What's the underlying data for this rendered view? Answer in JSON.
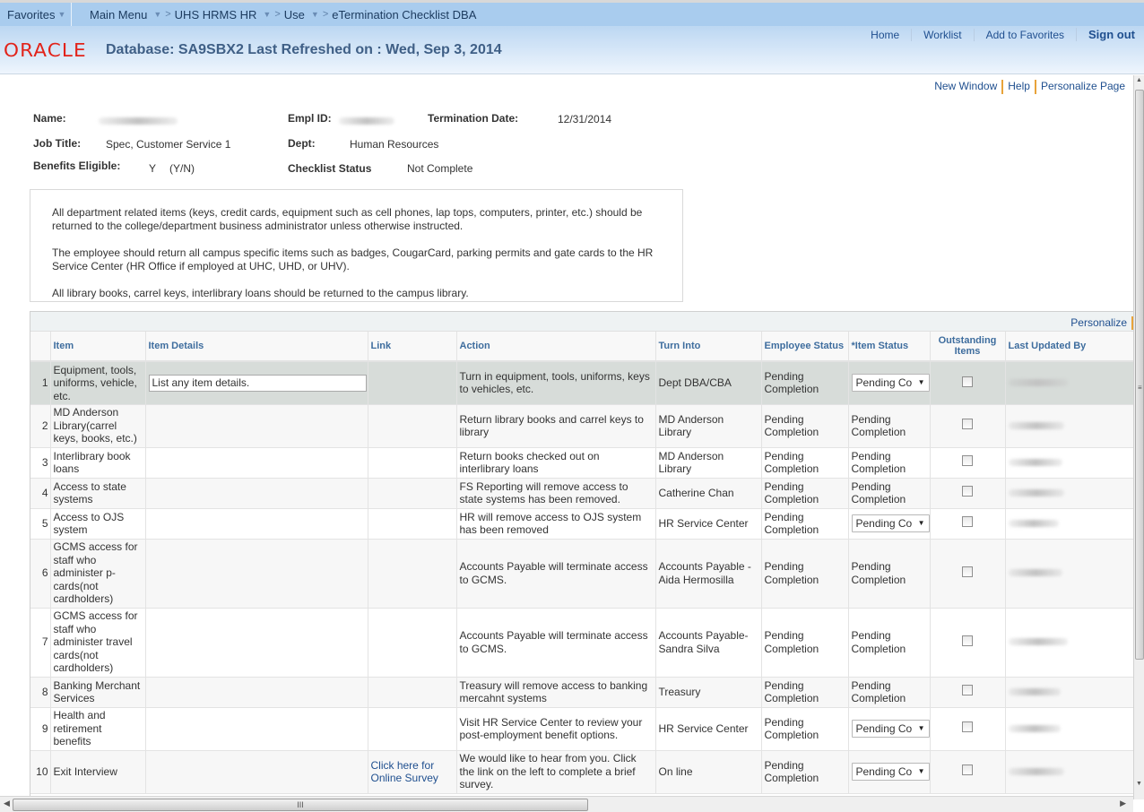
{
  "nav": {
    "favorites": "Favorites",
    "breadcrumb": [
      {
        "label": "Main Menu",
        "dropdown": true
      },
      {
        "label": "UHS HRMS HR",
        "dropdown": true
      },
      {
        "label": "Use",
        "dropdown": true
      },
      {
        "label": "eTermination Checklist DBA",
        "dropdown": false
      }
    ],
    "separator": ">"
  },
  "header": {
    "logo": "ORACLE",
    "title": "Database: SA9SBX2 Last Refreshed on : Wed, Sep 3, 2014",
    "links": [
      "Home",
      "Worklist",
      "Add to Favorites"
    ],
    "signout": "Sign out"
  },
  "page_links": [
    "New Window",
    "Help",
    "Personalize Page"
  ],
  "employee": {
    "name_label": "Name:",
    "name_value": "[redacted]",
    "emplid_label": "Empl ID:",
    "emplid_value": "[redacted]",
    "termdate_label": "Termination Date:",
    "termdate_value": "12/31/2014",
    "jobtitle_label": "Job Title:",
    "jobtitle_value": "Spec, Customer Service 1",
    "dept_label": "Dept:",
    "dept_value": "Human Resources",
    "benefits_label": "Benefits Eligible:",
    "benefits_value": "Y",
    "benefits_hint": "(Y/N)",
    "checklist_label": "Checklist Status",
    "checklist_value": "Not Complete"
  },
  "instructions": [
    "All department related items (keys, credit cards, equipment such as cell phones, lap tops, computers, printer, etc.) should be returned to the college/department business administrator unless otherwise instructed.",
    "The employee should return all campus specific items such as badges, CougarCard, parking permits and gate cards to the HR Service Center (HR Office if employed at UHC, UHD, or UHV).",
    "All library books, carrel keys, interlibrary loans should be returned to the campus library."
  ],
  "grid": {
    "personalize": "Personalize",
    "columns": [
      "",
      "Item",
      "Item Details",
      "Link",
      "Action",
      "Turn Into",
      "Employee Status",
      "*Item Status",
      "Outstanding Items",
      "Last Updated By"
    ],
    "details_placeholder": "List any item details.",
    "rows": [
      {
        "num": "1",
        "item": "Equipment, tools, uniforms, vehicle, etc.",
        "details_input": true,
        "details": "List any item details.",
        "link": "",
        "action": "Turn in equipment, tools, uniforms, keys to vehicles, etc.",
        "turn_into": "Dept DBA/CBA",
        "emp_status": "Pending Completion",
        "item_status": "Pending Co",
        "item_status_editable": true,
        "outstanding": false,
        "last_updated_by": "[redacted]"
      },
      {
        "num": "2",
        "item": "MD Anderson Library(carrel keys, books, etc.)",
        "details_input": false,
        "details": "",
        "link": "",
        "action": "Return library books and carrel keys to library",
        "turn_into": "MD Anderson Library",
        "emp_status": "Pending Completion",
        "item_status": "Pending Completion",
        "item_status_editable": false,
        "outstanding": false,
        "last_updated_by": "[redacted]"
      },
      {
        "num": "3",
        "item": "Interlibrary book loans",
        "details_input": false,
        "details": "",
        "link": "",
        "action": "Return books checked out on interlibrary loans",
        "turn_into": "MD Anderson Library",
        "emp_status": "Pending Completion",
        "item_status": "Pending Completion",
        "item_status_editable": false,
        "outstanding": false,
        "last_updated_by": "[redacted]"
      },
      {
        "num": "4",
        "item": "Access to state systems",
        "details_input": false,
        "details": "",
        "link": "",
        "action": "FS Reporting will remove access to state systems has been removed.",
        "turn_into": "Catherine Chan",
        "emp_status": "Pending Completion",
        "item_status": "Pending Completion",
        "item_status_editable": false,
        "outstanding": false,
        "last_updated_by": "[redacted]"
      },
      {
        "num": "5",
        "item": "Access to OJS system",
        "details_input": false,
        "details": "",
        "link": "",
        "action": "HR will remove access to OJS system has been removed",
        "turn_into": "HR Service Center",
        "emp_status": "Pending Completion",
        "item_status": "Pending Co",
        "item_status_editable": true,
        "outstanding": false,
        "last_updated_by": "[redacted]"
      },
      {
        "num": "6",
        "item": "GCMS access for staff who administer p-cards(not cardholders)",
        "details_input": false,
        "details": "",
        "link": "",
        "action": "Accounts Payable will terminate access to GCMS.",
        "turn_into": "Accounts Payable -Aida Hermosilla",
        "emp_status": "Pending Completion",
        "item_status": "Pending Completion",
        "item_status_editable": false,
        "outstanding": false,
        "last_updated_by": "[redacted]"
      },
      {
        "num": "7",
        "item": "GCMS access for staff who administer travel cards(not cardholders)",
        "details_input": false,
        "details": "",
        "link": "",
        "action": "Accounts Payable will terminate access to GCMS.",
        "turn_into": "Accounts Payable- Sandra Silva",
        "emp_status": "Pending Completion",
        "item_status": "Pending Completion",
        "item_status_editable": false,
        "outstanding": false,
        "last_updated_by": "[redacted]"
      },
      {
        "num": "8",
        "item": "Banking Merchant Services",
        "details_input": false,
        "details": "",
        "link": "",
        "action": "Treasury will remove access to banking mercahnt systems",
        "turn_into": "Treasury",
        "emp_status": "Pending Completion",
        "item_status": "Pending Completion",
        "item_status_editable": false,
        "outstanding": false,
        "last_updated_by": "[redacted]"
      },
      {
        "num": "9",
        "item": "Health and retirement benefits",
        "details_input": false,
        "details": "",
        "link": "",
        "action": "Visit HR Service Center to review your post-employment benefit options.",
        "turn_into": "HR Service Center",
        "emp_status": "Pending Completion",
        "item_status": "Pending Co",
        "item_status_editable": true,
        "outstanding": false,
        "last_updated_by": "[redacted]"
      },
      {
        "num": "10",
        "item": "Exit Interview",
        "details_input": false,
        "details": "",
        "link": "Click here for Online Survey",
        "action": "We would like to hear from you. Click the link on the left to complete a brief survey.",
        "turn_into": "On line",
        "emp_status": "Pending Completion",
        "item_status": "Pending Co",
        "item_status_editable": true,
        "outstanding": false,
        "last_updated_by": "[redacted]"
      }
    ]
  },
  "icons": {
    "dropdown": "▼",
    "scroll_up": "▲",
    "scroll_down": "▼",
    "scroll_left": "◀",
    "scroll_right": "▶",
    "grip": "≡",
    "hgrip": "III"
  }
}
